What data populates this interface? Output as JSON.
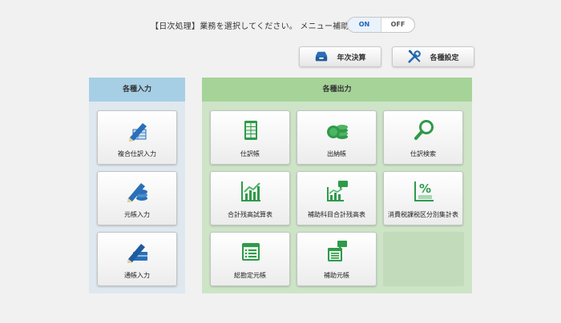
{
  "header": {
    "prompt": "【日次処理】業務を選択してください。 メニュー補助",
    "toggle_on": "ON",
    "toggle_off": "OFF"
  },
  "toolbar": {
    "nenji_label": "年次決算",
    "nenji_icon": "tray-icon",
    "settings_label": "各種設定",
    "settings_icon": "tools-icon"
  },
  "left_panel": {
    "title": "各種入力",
    "items": [
      {
        "label": "複合仕訳入力",
        "icon": "pen-ledger-icon"
      },
      {
        "label": "元帳入力",
        "icon": "pen-coins-icon"
      },
      {
        "label": "通帳入力",
        "icon": "pen-passbook-icon"
      }
    ]
  },
  "right_panel": {
    "title": "各種出力",
    "items": [
      {
        "label": "仕訳帳",
        "icon": "journal-icon"
      },
      {
        "label": "出納帳",
        "icon": "cashbook-icon"
      },
      {
        "label": "仕訳検索",
        "icon": "search-icon"
      },
      {
        "label": "合計残高試算表",
        "icon": "bar-chart-icon"
      },
      {
        "label": "補助科目合計残高表",
        "icon": "sub-chart-icon"
      },
      {
        "label": "消費税課税区分別集計表",
        "icon": "percent-icon"
      },
      {
        "label": "総勘定元帳",
        "icon": "ledger-icon"
      },
      {
        "label": "補助元帳",
        "icon": "sub-ledger-icon"
      }
    ]
  },
  "colors": {
    "accent_green": "#2f9a4a",
    "accent_blue": "#2a6fb8"
  }
}
